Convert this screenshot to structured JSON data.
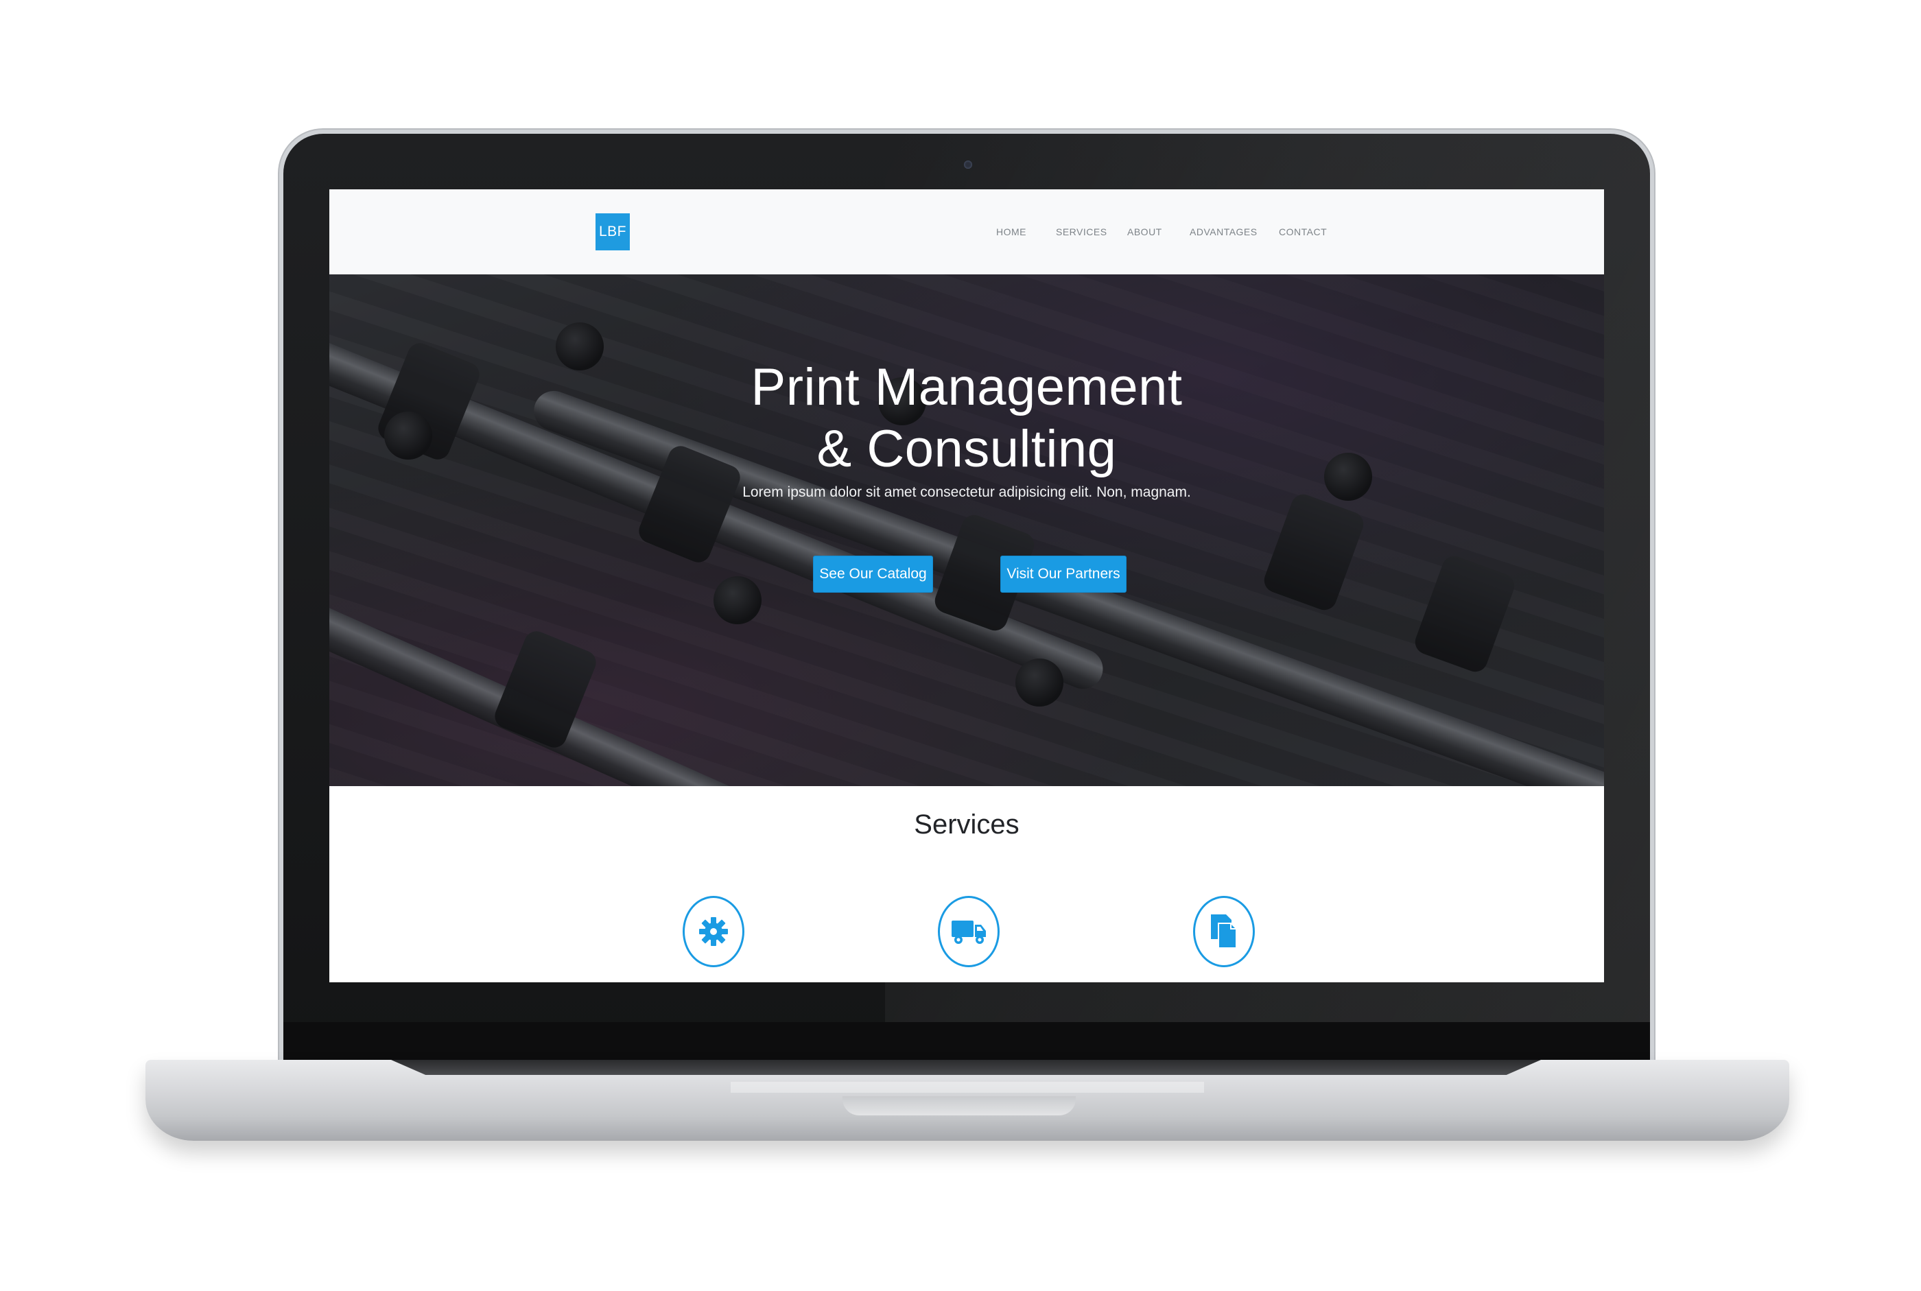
{
  "brand": {
    "logo_text": "LBF",
    "accent_color": "#1a9be3"
  },
  "nav": {
    "items": [
      {
        "label": "HOME"
      },
      {
        "label": "SERVICES"
      },
      {
        "label": "ABOUT"
      },
      {
        "label": "ADVANTAGES"
      },
      {
        "label": "CONTACT"
      }
    ]
  },
  "hero": {
    "title_line1": "Print Management",
    "title_line2": "& Consulting",
    "lead": "Lorem ipsum dolor sit amet consectetur adipisicing elit. Non, magnam.",
    "buttons": {
      "catalog": "See Our Catalog",
      "partners": "Visit Our Partners"
    }
  },
  "services": {
    "title": "Services",
    "icons": [
      {
        "icon": "gear-icon"
      },
      {
        "icon": "truck-icon"
      },
      {
        "icon": "documents-icon"
      }
    ]
  }
}
